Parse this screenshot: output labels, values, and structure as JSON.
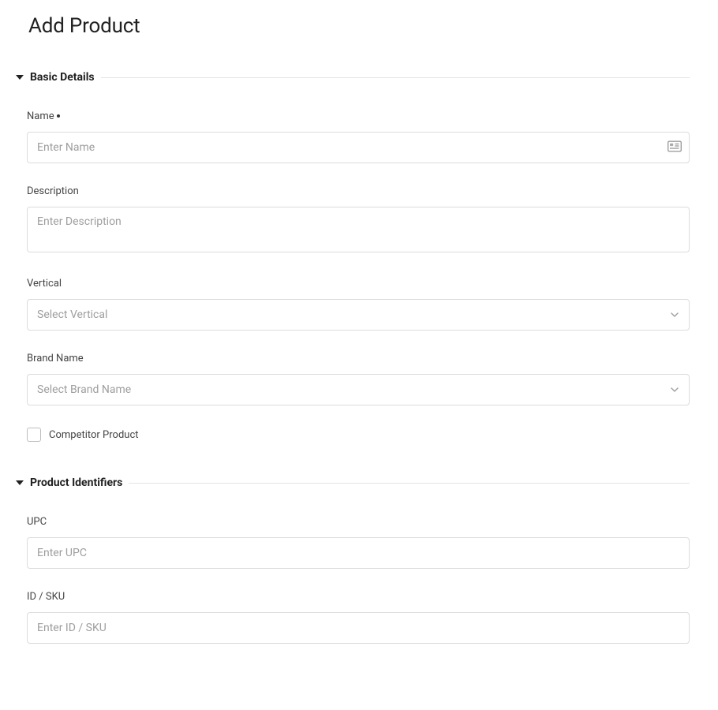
{
  "page": {
    "title": "Add Product"
  },
  "sections": {
    "basic": {
      "title": "Basic Details",
      "fields": {
        "name": {
          "label": "Name",
          "required": true,
          "placeholder": "Enter Name",
          "value": ""
        },
        "description": {
          "label": "Description",
          "placeholder": "Enter Description",
          "value": ""
        },
        "vertical": {
          "label": "Vertical",
          "placeholder": "Select Vertical",
          "value": ""
        },
        "brand": {
          "label": "Brand Name",
          "placeholder": "Select Brand Name",
          "value": ""
        },
        "competitor": {
          "label": "Competitor Product",
          "checked": false
        }
      }
    },
    "identifiers": {
      "title": "Product Identifiers",
      "fields": {
        "upc": {
          "label": "UPC",
          "placeholder": "Enter UPC",
          "value": ""
        },
        "sku": {
          "label": "ID / SKU",
          "placeholder": "Enter ID / SKU",
          "value": ""
        }
      }
    }
  }
}
